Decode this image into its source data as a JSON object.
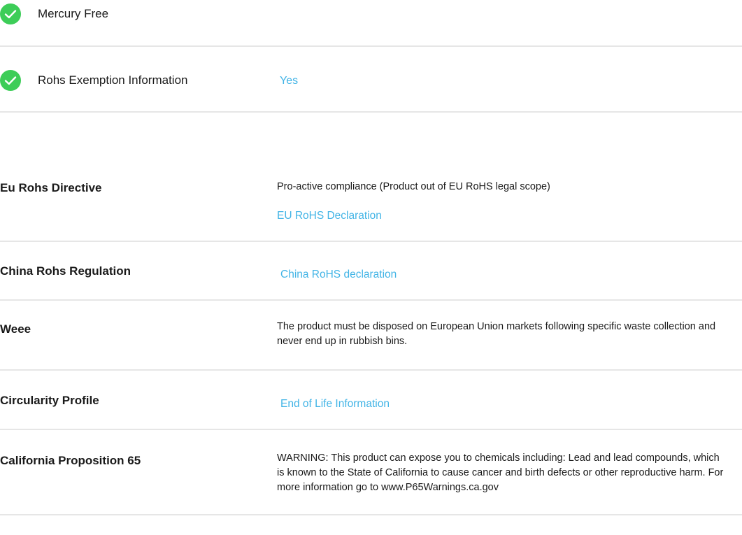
{
  "features": [
    {
      "icon": "check-circle-icon",
      "label": "Mercury Free",
      "value": ""
    },
    {
      "icon": "check-circle-icon",
      "label": "Rohs Exemption Information",
      "value": "Yes"
    }
  ],
  "regulations": {
    "eu_rohs": {
      "label": "Eu Rohs Directive",
      "text": "Pro-active compliance (Product out of EU RoHS legal scope)",
      "link": "EU RoHS Declaration"
    },
    "china_rohs": {
      "label": "China Rohs Regulation",
      "link": "China RoHS declaration"
    },
    "weee": {
      "label": "Weee",
      "text": "The product must be disposed on European Union markets following specific waste collection and never end up in rubbish bins."
    },
    "circularity": {
      "label": "Circularity Profile",
      "link": "End of Life Information"
    },
    "prop65": {
      "label": "California Proposition 65",
      "text": "WARNING: This product can expose you to chemicals including: Lead and lead compounds, which is known to the State of California to cause cancer and birth defects or other reproductive harm. For more information go to www.P65Warnings.ca.gov"
    }
  },
  "colors": {
    "check": "#3dcd58",
    "link": "#42b4e6",
    "divider": "#e6e6e6",
    "text": "#1a1a1a"
  }
}
